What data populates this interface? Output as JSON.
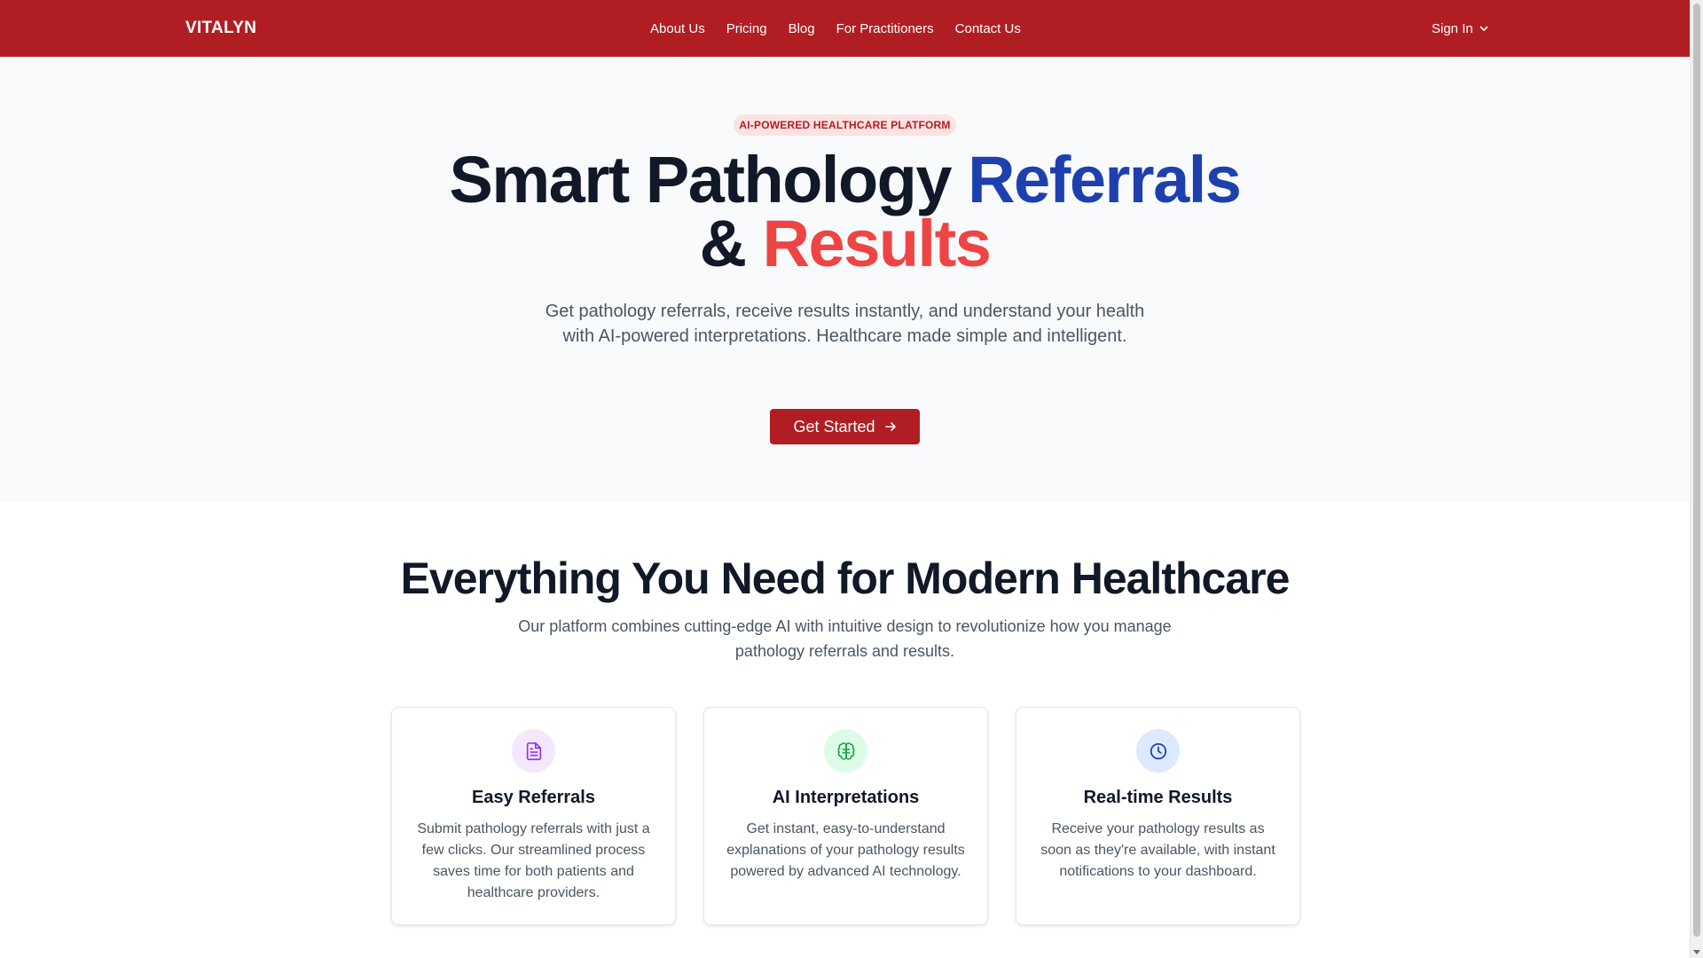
{
  "brand": "VITALYN",
  "nav": {
    "links": [
      "About Us",
      "Pricing",
      "Blog",
      "For Practitioners",
      "Contact Us"
    ],
    "signin": "Sign In"
  },
  "hero": {
    "badge": "AI-POWERED HEALTHCARE PLATFORM",
    "title_part1": "Smart Pathology",
    "title_part2": "Referrals",
    "title_part3": "&",
    "title_part4": "Results",
    "subtitle": "Get pathology referrals, receive results instantly, and understand your health with AI-powered interpretations. Healthcare made simple and intelligent.",
    "cta": "Get Started"
  },
  "features": {
    "title": "Everything You Need for Modern Healthcare",
    "subtitle": "Our platform combines cutting-edge AI with intuitive design to revolutionize how you manage pathology referrals and results.",
    "cards": [
      {
        "icon": "document-icon",
        "title": "Easy Referrals",
        "desc": "Submit pathology referrals with just a few clicks. Our streamlined process saves time for both patients and healthcare providers.",
        "icon_bg": "#f3e8ff",
        "icon_color": "#9333ea"
      },
      {
        "icon": "brain-icon",
        "title": "AI Interpretations",
        "desc": "Get instant, easy-to-understand explanations of your pathology results powered by advanced AI technology.",
        "icon_bg": "#dcfce7",
        "icon_color": "#16a34a"
      },
      {
        "icon": "clock-icon",
        "title": "Real-time Results",
        "desc": "Receive your pathology results as soon as they're available, with instant notifications to your dashboard.",
        "icon_bg": "#dbeafe",
        "icon_color": "#1e40af"
      }
    ]
  },
  "colors": {
    "primary": "#b01e24",
    "accent_blue": "#1e40af",
    "accent_red": "#ef4444"
  }
}
